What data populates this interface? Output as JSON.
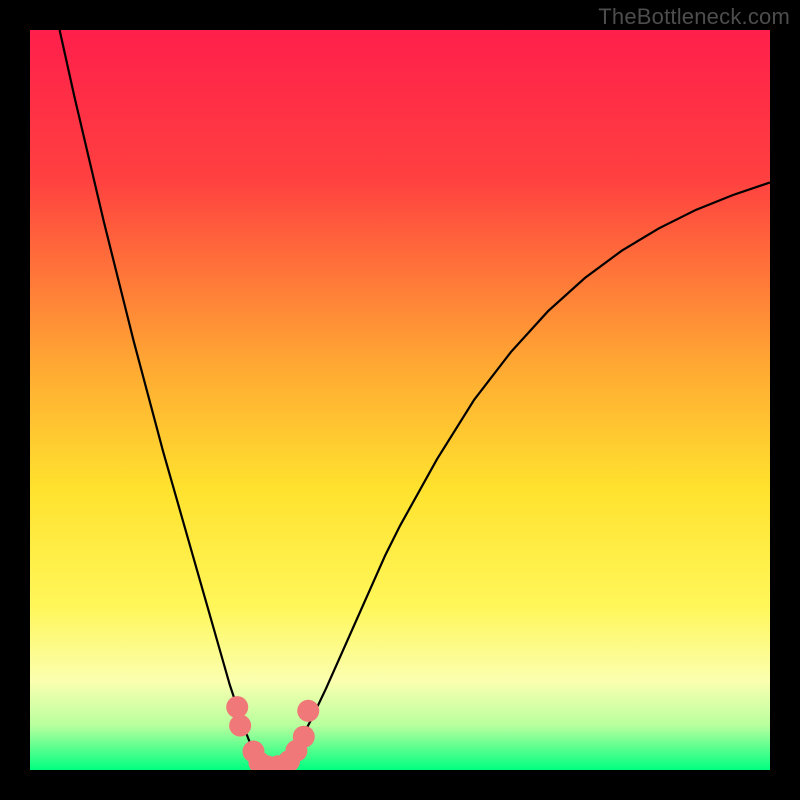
{
  "watermark": "TheBottleneck.com",
  "chart_data": {
    "type": "line",
    "title": "",
    "xlabel": "",
    "ylabel": "",
    "xlim": [
      0,
      100
    ],
    "ylim": [
      0,
      100
    ],
    "background_gradient": {
      "stops": [
        {
          "offset": 0,
          "color": "#ff1f4b"
        },
        {
          "offset": 0.2,
          "color": "#ff4040"
        },
        {
          "offset": 0.45,
          "color": "#ffa733"
        },
        {
          "offset": 0.62,
          "color": "#ffe22e"
        },
        {
          "offset": 0.78,
          "color": "#fff75a"
        },
        {
          "offset": 0.88,
          "color": "#fbffb0"
        },
        {
          "offset": 0.94,
          "color": "#b8ff9e"
        },
        {
          "offset": 1.0,
          "color": "#00ff80"
        }
      ]
    },
    "series": [
      {
        "name": "curve",
        "stroke": "#000000",
        "stroke_width": 2.2,
        "x": [
          4.0,
          6.0,
          8.0,
          10.0,
          12.0,
          14.0,
          16.0,
          18.0,
          20.0,
          22.0,
          23.0,
          24.0,
          25.0,
          26.0,
          27.0,
          28.0,
          29.0,
          30.0,
          31.0,
          32.0,
          33.0,
          34.0,
          35.0,
          36.0,
          38.0,
          40.0,
          42.0,
          44.0,
          46.0,
          48.0,
          50.0,
          55.0,
          60.0,
          65.0,
          70.0,
          75.0,
          80.0,
          85.0,
          90.0,
          95.0,
          100.0
        ],
        "y": [
          100.0,
          91.0,
          82.5,
          74.0,
          66.0,
          58.0,
          50.5,
          43.0,
          36.0,
          29.0,
          25.5,
          22.0,
          18.5,
          15.0,
          11.5,
          8.5,
          5.5,
          3.0,
          1.2,
          0.3,
          0.0,
          0.3,
          1.2,
          3.0,
          6.8,
          11.0,
          15.5,
          20.0,
          24.5,
          29.0,
          33.0,
          42.0,
          50.0,
          56.5,
          62.0,
          66.5,
          70.2,
          73.2,
          75.7,
          77.7,
          79.4
        ]
      }
    ],
    "markers": {
      "name": "highlight-dots",
      "fill": "#f07878",
      "radius": 11,
      "points": [
        {
          "x": 28.0,
          "y": 8.5
        },
        {
          "x": 28.4,
          "y": 6.0
        },
        {
          "x": 30.2,
          "y": 2.5
        },
        {
          "x": 31.0,
          "y": 1.0
        },
        {
          "x": 32.0,
          "y": 0.5
        },
        {
          "x": 33.5,
          "y": 0.5
        },
        {
          "x": 35.0,
          "y": 1.2
        },
        {
          "x": 36.0,
          "y": 2.6
        },
        {
          "x": 37.0,
          "y": 4.5
        },
        {
          "x": 37.6,
          "y": 8.0
        }
      ]
    }
  }
}
